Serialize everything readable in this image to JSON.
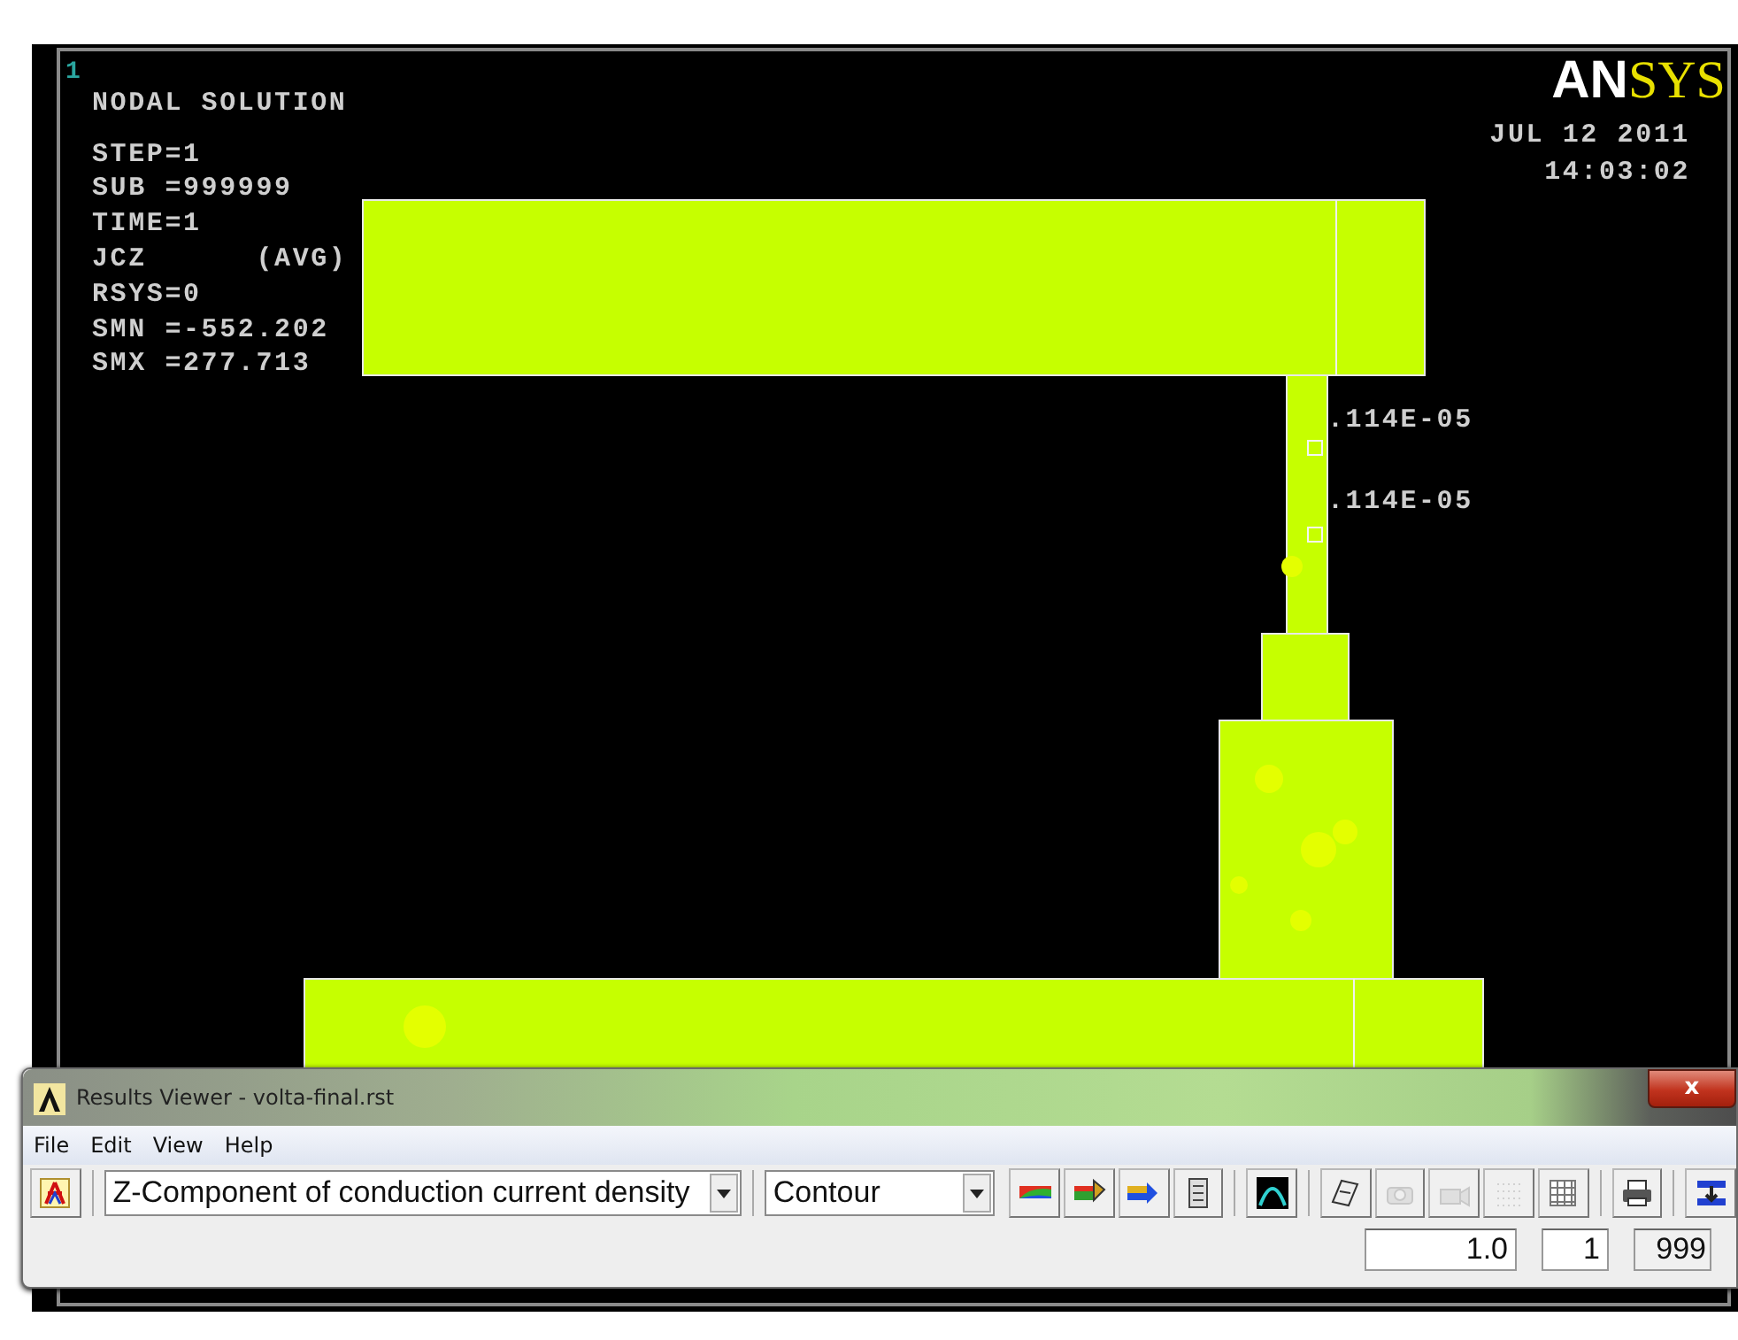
{
  "viewport": {
    "window_number": "1",
    "annotations": [
      "NODAL SOLUTION",
      "STEP=1",
      "SUB =999999",
      "TIME=1",
      "JCZ      (AVG)",
      "RSYS=0",
      "SMN =-552.202",
      "SMX =277.713"
    ],
    "logo": {
      "left": "AN",
      "right": "SYS"
    },
    "date": "JUL 12 2011",
    "time": "14:03:02",
    "node_labels": [
      ".114E-05",
      ".114E-05"
    ]
  },
  "results_viewer": {
    "title": "Results Viewer -  volta-final.rst",
    "close": "x",
    "menu": [
      "File",
      "Edit",
      "View",
      "Help"
    ],
    "result_item": "Z-Component of conduction current density",
    "plot_type": "Contour",
    "toolbar_buttons": [
      {
        "disabled": false
      },
      {
        "disabled": false
      },
      {
        "disabled": false
      },
      {
        "disabled": false
      },
      {
        "disabled": false
      },
      {
        "disabled": false
      },
      {
        "disabled": true
      },
      {
        "disabled": true
      },
      {
        "disabled": true
      },
      {
        "disabled": false
      },
      {
        "disabled": false
      },
      {
        "disabled": false
      }
    ],
    "fields": [
      "1.0",
      "1",
      "999"
    ]
  }
}
